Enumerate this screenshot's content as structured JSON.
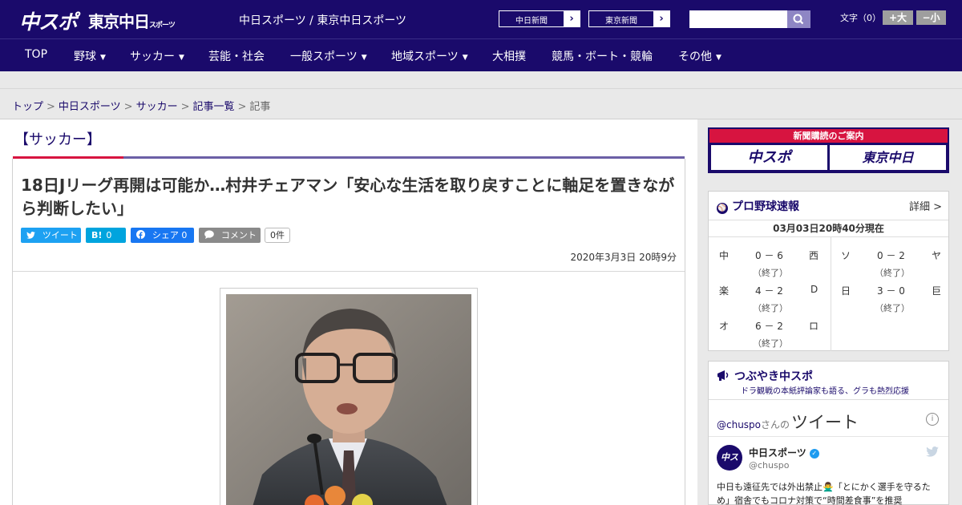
{
  "header": {
    "logo_chuspo": "中スポ",
    "logo_tokyo": "東京中日",
    "logo_tokyo_small": "スポーツ",
    "tagline": "中日スポーツ / 東京中日スポーツ",
    "paper_links": [
      {
        "label": "中日新聞",
        "arrow": "›"
      },
      {
        "label": "東京新聞",
        "arrow": "›"
      }
    ],
    "search": {
      "value": "",
      "placeholder": ""
    },
    "search_icon": "search-icon",
    "font_size": {
      "label": "文字（0）",
      "larger": "+大",
      "smaller": "−小"
    }
  },
  "nav": {
    "items": [
      {
        "label": "TOP",
        "chevron": ""
      },
      {
        "label": "野球",
        "chevron": "▼"
      },
      {
        "label": "サッカー",
        "chevron": "▼"
      },
      {
        "label": "芸能・社会",
        "chevron": ""
      },
      {
        "label": "一般スポーツ",
        "chevron": "▼"
      },
      {
        "label": "地域スポーツ",
        "chevron": "▼"
      },
      {
        "label": "大相撲",
        "chevron": ""
      },
      {
        "label": "競馬・ボート・競輪",
        "chevron": ""
      },
      {
        "label": "その他",
        "chevron": "▼"
      }
    ]
  },
  "breadcrumb": {
    "items": [
      "トップ",
      "中日スポーツ",
      "サッカー",
      "記事一覧"
    ],
    "current": "記事",
    "separator": ">"
  },
  "article": {
    "category": "【サッカー】",
    "headline": "18日Jリーグ再開は可能か…村井チェアマン「安心な生活を取り戻すことに軸足を置きながら判断したい」",
    "share": {
      "tweet": {
        "icon": "🐦",
        "label": "ツイート"
      },
      "hatena": {
        "icon": "B!",
        "label": "0"
      },
      "facebook": {
        "icon": "f",
        "label": "シェア 0"
      },
      "comment": {
        "icon": "💬",
        "label": "コメント"
      },
      "comment_count": "0件"
    },
    "date": "2020年3月3日 20時9分",
    "photo_icon": "article-photo"
  },
  "sidebar": {
    "subscribe": {
      "title": "新聞購読のご案内",
      "logos": [
        "中スポ",
        "東京中日"
      ]
    },
    "scores": {
      "title": "プロ野球速報",
      "detail_link": "詳細 >",
      "updated": "03月03日20時40分現在",
      "left_games": [
        {
          "home": "中",
          "score": "0 － 6",
          "away": "西",
          "status": "（終了）"
        },
        {
          "home": "楽",
          "score": "4 － 2",
          "away": "D",
          "status": "（終了）"
        },
        {
          "home": "オ",
          "score": "6 － 2",
          "away": "ロ",
          "status": "（終了）"
        }
      ],
      "right_games": [
        {
          "home": "ソ",
          "score": "0 － 2",
          "away": "ヤ",
          "status": "（終了）"
        },
        {
          "home": "日",
          "score": "3 － 0",
          "away": "巨",
          "status": "（終了）"
        }
      ]
    },
    "twitter": {
      "title": "つぶやき中スポ",
      "subtitle": "ドラ観戦の本紙評論家も語る、グラも熱烈応援",
      "handle": "@chuspo",
      "handle_suffix": "さんの",
      "heading": "ツイート",
      "info": "i",
      "avatar": "中スポ",
      "account_name": "中日スポーツ",
      "account_user": "@chuspo",
      "tweet_text": "中日も遠征先では外出禁止🙅‍♂️「とにかく選手を守るため」宿舎でもコロナ対策で“時間差食事”を推奨"
    }
  },
  "colors": {
    "brand": "#1a0a6b",
    "accent_red": "#d71440",
    "accent_purple": "#6b5fa6"
  }
}
